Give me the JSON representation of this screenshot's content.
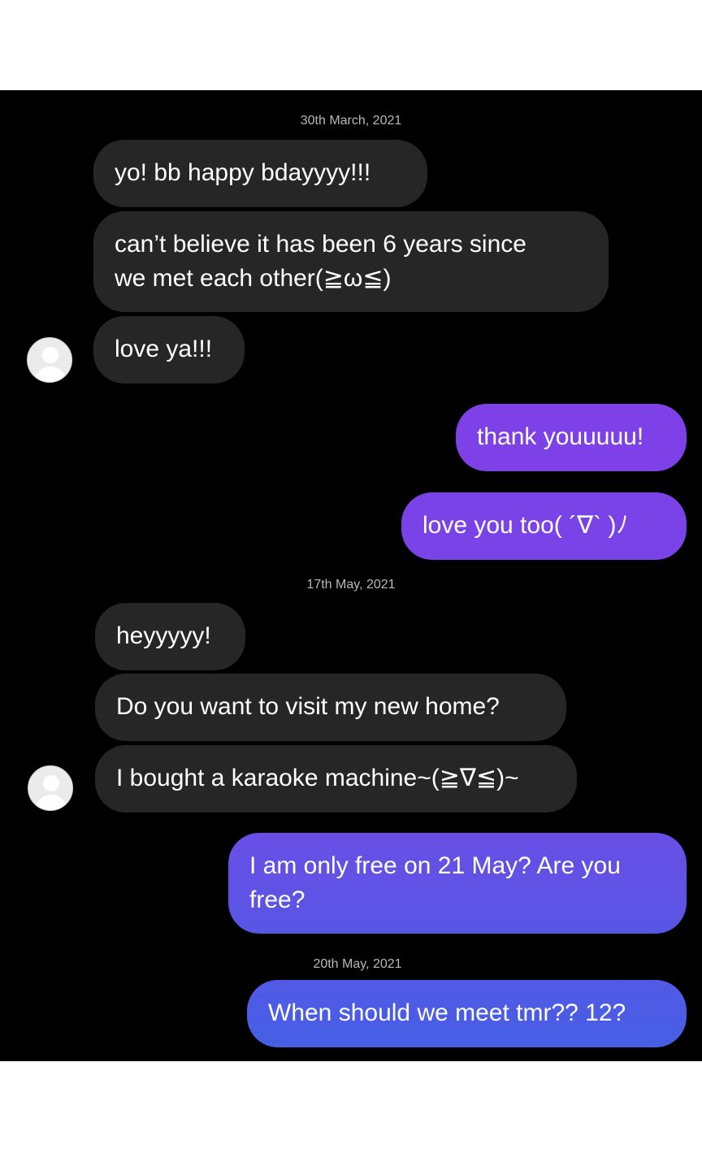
{
  "sections": [
    {
      "date": "30th March, 2021",
      "received": [
        "yo! bb happy bdayyyy!!!",
        "can’t believe it has been 6 years since",
        "we met each other(≧ω≦)",
        "love ya!!!"
      ],
      "sent": [
        "thank youuuuu!",
        "love you too( ´∇` )ﾉ"
      ]
    },
    {
      "date": "17th May, 2021",
      "received": [
        "heyyyyy!",
        "Do you want to visit my new home?",
        "I bought a karaoke machine~(≧∇≦)~"
      ],
      "sent": [
        "I am only free on 21 May? Are you",
        "free?"
      ]
    },
    {
      "date": "20th May, 2021",
      "sent": [
        "When should we meet tmr?? 12?"
      ]
    }
  ],
  "colors": {
    "chat_background": "#000000",
    "received_bubble": "#262626",
    "sent_bubble_top": "#8a3fe6",
    "sent_bubble_bottom": "#4b5ce4",
    "date_text": "#b8b8b8"
  },
  "icons": {
    "avatar": "user-avatar-icon"
  }
}
